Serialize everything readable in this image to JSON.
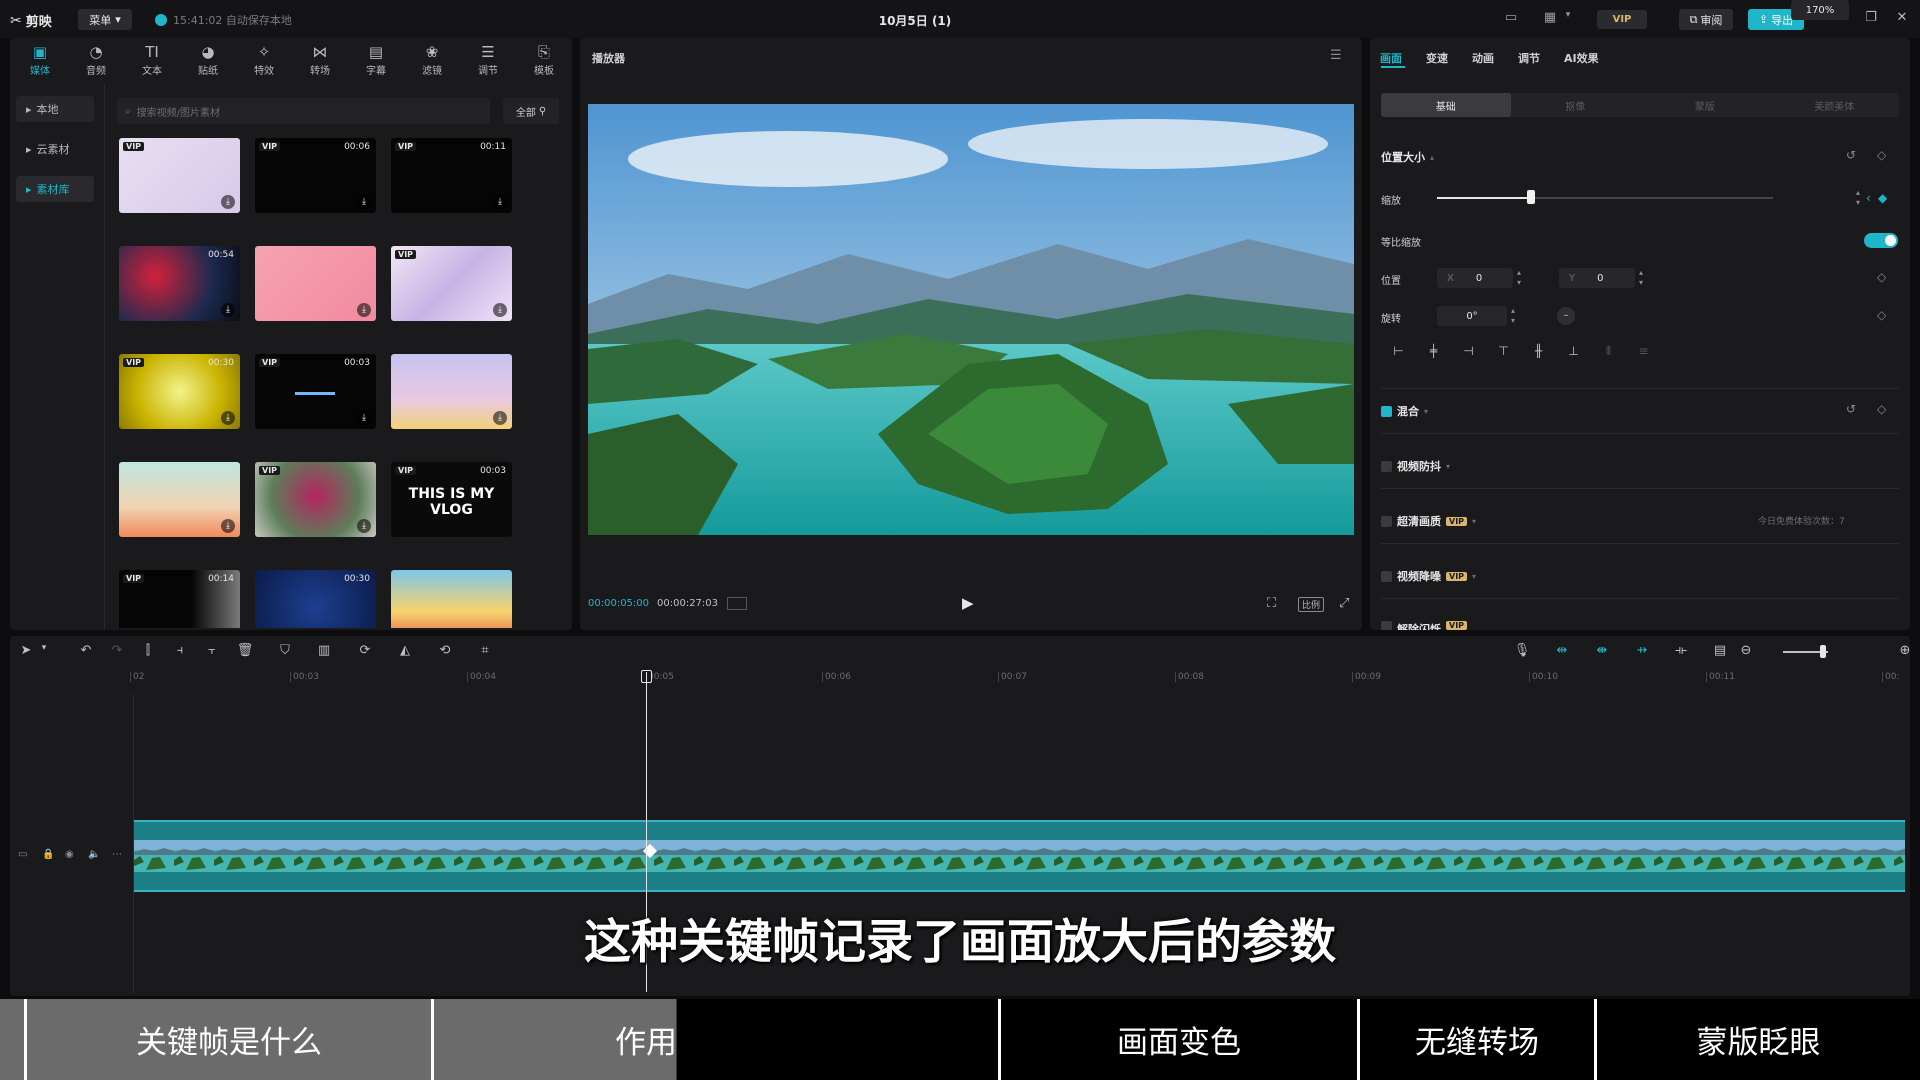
{
  "app": {
    "name": "剪映",
    "menu_label": "菜单",
    "save_status": "15:41:02 自动保存本地",
    "doc_title": "10月5日 (1)",
    "vip": "VIP",
    "review_label": "审阅",
    "export_label": "导出"
  },
  "media_tabs": [
    {
      "label": "媒体",
      "icon": "media-icon"
    },
    {
      "label": "音频",
      "icon": "audio-icon"
    },
    {
      "label": "文本",
      "icon": "text-icon"
    },
    {
      "label": "贴纸",
      "icon": "sticker-icon"
    },
    {
      "label": "特效",
      "icon": "effects-icon"
    },
    {
      "label": "转场",
      "icon": "transition-icon"
    },
    {
      "label": "字幕",
      "icon": "caption-icon"
    },
    {
      "label": "滤镜",
      "icon": "filter-icon"
    },
    {
      "label": "调节",
      "icon": "adjust-icon"
    },
    {
      "label": "模板",
      "icon": "template-icon"
    }
  ],
  "side_nav": [
    "本地",
    "云素材",
    "素材库"
  ],
  "search": {
    "placeholder": "搜索视频/图片素材"
  },
  "filter_label": "全部",
  "thumbs": [
    {
      "vip": "VIP",
      "dur": ""
    },
    {
      "vip": "VIP",
      "dur": "00:06"
    },
    {
      "vip": "VIP",
      "dur": "00:11"
    },
    {
      "vip": "",
      "dur": "00:54"
    },
    {
      "vip": "",
      "dur": ""
    },
    {
      "vip": "VIP",
      "dur": ""
    },
    {
      "vip": "VIP",
      "dur": "00:30"
    },
    {
      "vip": "VIP",
      "dur": "00:03"
    },
    {
      "vip": "",
      "dur": ""
    },
    {
      "vip": "",
      "dur": ""
    },
    {
      "vip": "VIP",
      "dur": ""
    },
    {
      "vip": "VIP",
      "dur": "00:03",
      "text": "THIS IS MY VLOG"
    },
    {
      "vip": "VIP",
      "dur": "00:14"
    },
    {
      "vip": "",
      "dur": "00:30"
    },
    {
      "vip": "",
      "dur": ""
    }
  ],
  "player": {
    "title": "播放器",
    "current_time": "00:00:05:00",
    "total_time": "00:00:27:03",
    "ratio_label": "比例"
  },
  "props": {
    "tabs": [
      "画面",
      "变速",
      "动画",
      "调节",
      "AI效果"
    ],
    "subtabs": [
      "基础",
      "抠像",
      "蒙版",
      "美颜美体"
    ],
    "section_pos_size": "位置大小",
    "scale_label": "缩放",
    "scale_value": "170%",
    "scale_fraction": 0.28,
    "uniform_scale_label": "等比缩放",
    "position_label": "位置",
    "x_axis": "X",
    "x_value": "0",
    "y_axis": "Y",
    "y_value": "0",
    "rotate_label": "旋转",
    "rotate_value": "0°",
    "blend_label": "混合",
    "stabilize_label": "视频防抖",
    "super_res_label": "超清画质",
    "super_res_note": "今日免费体验次数：7",
    "denoise_label": "视频降噪",
    "flicker_label": "解除闪烁"
  },
  "ruler": [
    "02",
    "00:03",
    "00:04",
    "00:05",
    "00:06",
    "00:07",
    "00:08",
    "00:09",
    "00:10",
    "00:11",
    "00:"
  ],
  "subtitle": "这种关键帧记录了画面放大后的参数",
  "chapters": [
    "关键帧是什么",
    "作用",
    "画面变色",
    "无缝转场",
    "蒙版眨眼"
  ]
}
